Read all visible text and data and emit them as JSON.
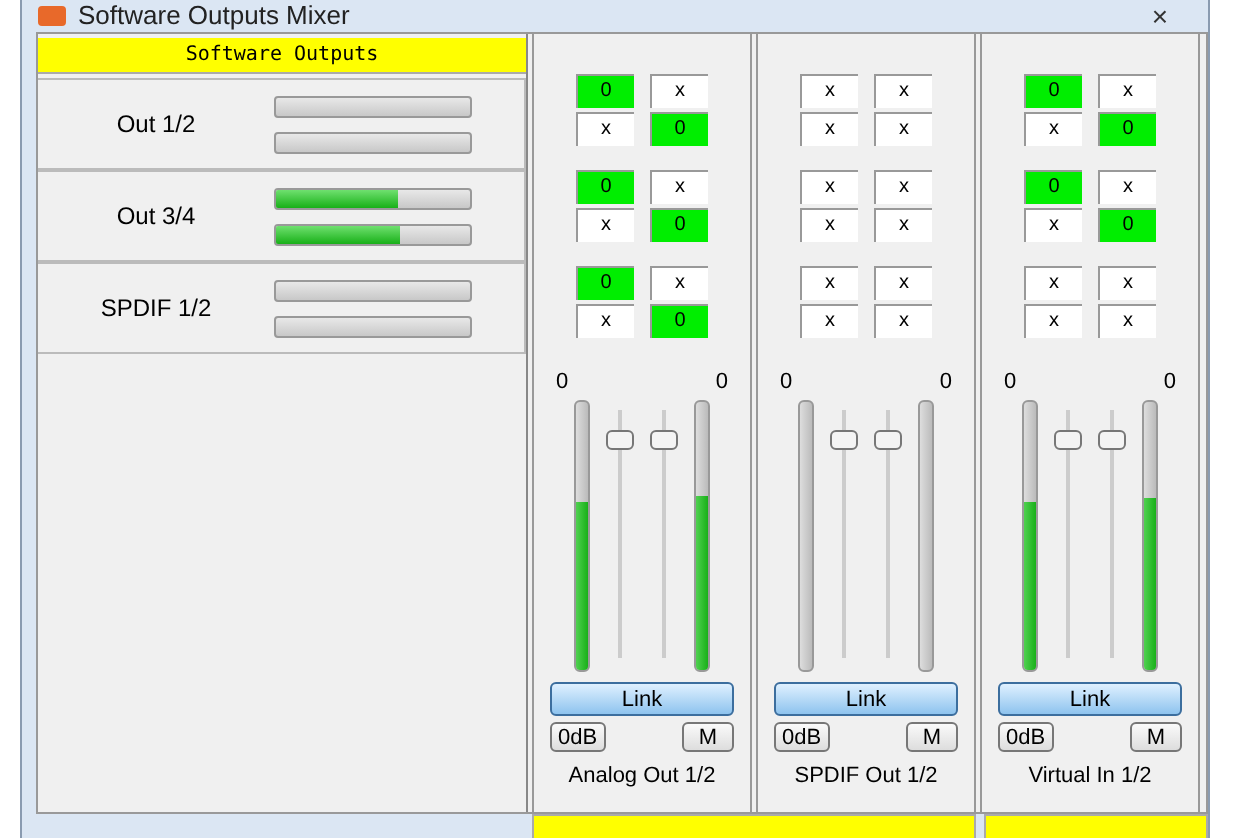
{
  "window": {
    "title": "Software Outputs Mixer",
    "close": "×"
  },
  "outputs_header": "Software Outputs",
  "outputs": [
    {
      "name": "Out 1/2",
      "meters": [
        {
          "level": 0
        },
        {
          "level": 0
        }
      ]
    },
    {
      "name": "Out 3/4",
      "meters": [
        {
          "level": 0.63
        },
        {
          "level": 0.64
        }
      ]
    },
    {
      "name": "SPDIF 1/2",
      "meters": [
        {
          "level": 0
        },
        {
          "level": 0
        }
      ]
    }
  ],
  "strips": [
    {
      "name": "Analog Out 1/2",
      "matrix": [
        [
          {
            "text": "0",
            "on": true
          },
          {
            "text": "x",
            "on": false
          }
        ],
        [
          {
            "text": "x",
            "on": false
          },
          {
            "text": "0",
            "on": true
          }
        ],
        [
          {
            "text": "0",
            "on": true
          },
          {
            "text": "x",
            "on": false
          }
        ],
        [
          {
            "text": "x",
            "on": false
          },
          {
            "text": "0",
            "on": true
          }
        ],
        [
          {
            "text": "0",
            "on": true
          },
          {
            "text": "x",
            "on": false
          }
        ],
        [
          {
            "text": "x",
            "on": false
          },
          {
            "text": "0",
            "on": true
          }
        ]
      ],
      "readings": [
        "0",
        "0"
      ],
      "meters": [
        {
          "level": 0.63
        },
        {
          "level": 0.65
        }
      ],
      "faders": [
        {
          "level": 0.9
        },
        {
          "level": 0.9
        }
      ],
      "link": "Link",
      "zero_db": "0dB",
      "mute": "M"
    },
    {
      "name": "SPDIF Out 1/2",
      "matrix": [
        [
          {
            "text": "x",
            "on": false
          },
          {
            "text": "x",
            "on": false
          }
        ],
        [
          {
            "text": "x",
            "on": false
          },
          {
            "text": "x",
            "on": false
          }
        ],
        [
          {
            "text": "x",
            "on": false
          },
          {
            "text": "x",
            "on": false
          }
        ],
        [
          {
            "text": "x",
            "on": false
          },
          {
            "text": "x",
            "on": false
          }
        ],
        [
          {
            "text": "x",
            "on": false
          },
          {
            "text": "x",
            "on": false
          }
        ],
        [
          {
            "text": "x",
            "on": false
          },
          {
            "text": "x",
            "on": false
          }
        ]
      ],
      "readings": [
        "0",
        "0"
      ],
      "meters": [
        {
          "level": 0
        },
        {
          "level": 0
        }
      ],
      "faders": [
        {
          "level": 0.9
        },
        {
          "level": 0.9
        }
      ],
      "link": "Link",
      "zero_db": "0dB",
      "mute": "M"
    },
    {
      "name": "Virtual In 1/2",
      "matrix": [
        [
          {
            "text": "0",
            "on": true
          },
          {
            "text": "x",
            "on": false
          }
        ],
        [
          {
            "text": "x",
            "on": false
          },
          {
            "text": "0",
            "on": true
          }
        ],
        [
          {
            "text": "0",
            "on": true
          },
          {
            "text": "x",
            "on": false
          }
        ],
        [
          {
            "text": "x",
            "on": false
          },
          {
            "text": "0",
            "on": true
          }
        ],
        [
          {
            "text": "x",
            "on": false
          },
          {
            "text": "x",
            "on": false
          }
        ],
        [
          {
            "text": "x",
            "on": false
          },
          {
            "text": "x",
            "on": false
          }
        ]
      ],
      "readings": [
        "0",
        "0"
      ],
      "meters": [
        {
          "level": 0.63
        },
        {
          "level": 0.64
        }
      ],
      "faders": [
        {
          "level": 0.9
        },
        {
          "level": 0.9
        }
      ],
      "link": "Link",
      "zero_db": "0dB",
      "mute": "M"
    }
  ]
}
